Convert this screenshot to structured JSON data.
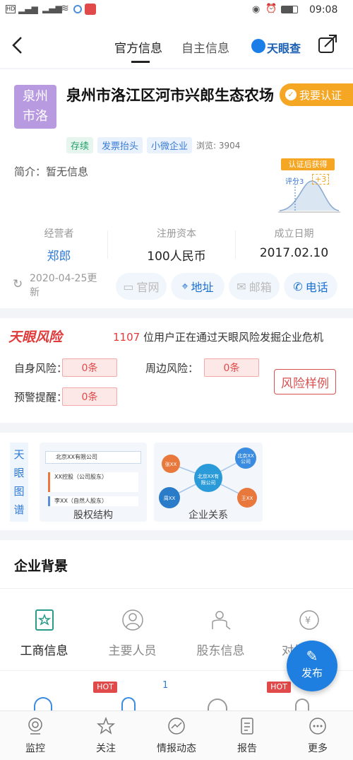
{
  "status": {
    "time": "09:08"
  },
  "nav": {
    "back_icon": "chevron-left-icon",
    "tabs": [
      "官方信息",
      "自主信息"
    ],
    "brand": "天眼查",
    "share_icon": "share-icon"
  },
  "company": {
    "logo_text": [
      "泉州",
      "市洛"
    ],
    "name": "泉州市洛江区河市兴郎生态农场",
    "certify": "我要认证",
    "tags": [
      {
        "text": "存续",
        "color": "#22a06b",
        "bg": "#e6f6ee"
      },
      {
        "text": "发票抬头",
        "color": "#3a7bd5",
        "bg": "#e8f1fc"
      },
      {
        "text": "小微企业",
        "color": "#3a7bd5",
        "bg": "#e8f1fc"
      }
    ],
    "views": "浏览: 3904",
    "intro": "简介：暂无信息",
    "badge_top": "认证后获得",
    "badge_score": "评分3",
    "badge_plus": "+3"
  },
  "stats": [
    {
      "label": "经营者",
      "value": "郑郎"
    },
    {
      "label": "注册资本",
      "value": "100人民币"
    },
    {
      "label": "成立日期",
      "value": "2017.02.10"
    }
  ],
  "update": {
    "date": "2020-04-25更",
    "date2": "新"
  },
  "actions": [
    {
      "label": "官网",
      "icon": "monitor-icon"
    },
    {
      "label": "地址",
      "icon": "location-icon"
    },
    {
      "label": "邮箱",
      "icon": "mail-icon"
    },
    {
      "label": "电话",
      "icon": "phone-icon"
    }
  ],
  "risk": {
    "brand": "天眼风险",
    "count": "1107",
    "desc": "位用户正在通过天眼风险发掘企业危机",
    "items": [
      {
        "label": "自身风险：",
        "value": "0条"
      },
      {
        "label": "周边风险：",
        "value": "0条"
      },
      {
        "label": "预警提醒：",
        "value": "0条"
      }
    ],
    "sample": "风险样例"
  },
  "graph": {
    "side_label": [
      "天",
      "眼",
      "图",
      "谱"
    ],
    "equity_title": "股权结构",
    "equity_company": "北京XX有限公司",
    "equity_row1": "XX控股（公司股东）",
    "equity_row2": "李XX（自然人股东）",
    "relation_title": "企业关系",
    "relation_center": "北京XX有限公司",
    "relation_nodes": [
      "张XX",
      "北京XX公司",
      "周XX",
      "王XX"
    ]
  },
  "background": {
    "title": "企业背景",
    "items": [
      {
        "label": "工商信息",
        "icon": "id-card-icon",
        "active": true
      },
      {
        "label": "主要人员",
        "icon": "person-icon",
        "active": false
      },
      {
        "label": "股东信息",
        "icon": "shareholder-icon",
        "active": false
      },
      {
        "label": "对外",
        "icon": "investment-icon",
        "active": false
      }
    ],
    "hot": "HOT",
    "badge_num": "1"
  },
  "fab": {
    "label": "发布"
  },
  "tabbar": [
    {
      "label": "监控",
      "icon": "monitor-camera-icon"
    },
    {
      "label": "关注",
      "icon": "star-icon"
    },
    {
      "label": "情报动态",
      "icon": "trend-icon"
    },
    {
      "label": "报告",
      "icon": "report-icon"
    },
    {
      "label": "更多",
      "icon": "more-icon"
    }
  ]
}
